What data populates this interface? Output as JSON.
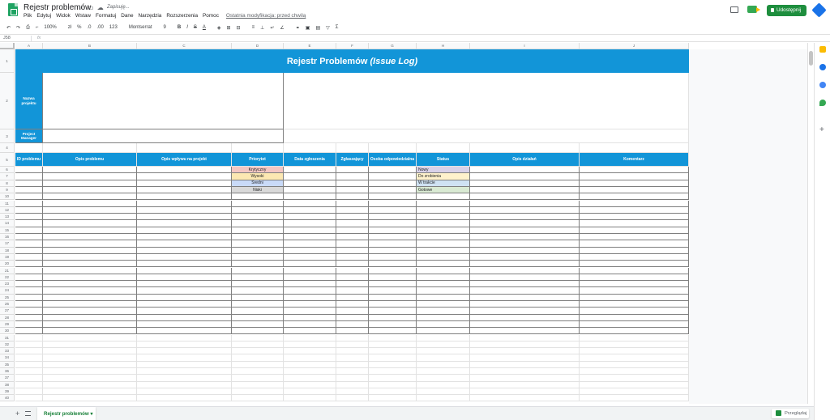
{
  "doc": {
    "title": "Rejestr problemów",
    "saving": "Zapisuję..."
  },
  "menu": [
    "Plik",
    "Edytuj",
    "Widok",
    "Wstaw",
    "Formatuj",
    "Dane",
    "Narzędzia",
    "Rozszerzenia",
    "Pomoc"
  ],
  "last_edit": "Ostatnia modyfikacja: przed chwilą",
  "share_label": "Udostępnij",
  "toolbar": {
    "zoom": "100%",
    "currency": "zł",
    "percent": "%",
    "dec_less": ".0",
    "dec_more": ".00",
    "num_format": "123",
    "font": "Montserrat",
    "font_size": "9",
    "bold": "B",
    "italic": "I",
    "strike": "S",
    "text_color": "A",
    "sigma": "Σ"
  },
  "formula_bar": {
    "namebox": "J58",
    "fx": "fx"
  },
  "columns": [
    "A",
    "B",
    "C",
    "D",
    "E",
    "F",
    "G",
    "H",
    "I",
    "J"
  ],
  "sheet": {
    "title": "Rejestr Problemów",
    "title_italic": "(Issue Log)",
    "project_labels": [
      "Nazwa projektu",
      "Project Manager"
    ],
    "headers": [
      "ID problemu",
      "Opis problemu",
      "Opis wpływu na projekt",
      "Priorytet",
      "Data zgłoszenia",
      "Zgłaszający",
      "Osoba odpowiedzialna",
      "Status",
      "Opis działań",
      "Komentarz"
    ],
    "priorities": [
      {
        "label": "Krytyczny",
        "color": "#f4c7c3"
      },
      {
        "label": "Wysoki",
        "color": "#fce8b2"
      },
      {
        "label": "Średni",
        "color": "#c9daf8"
      },
      {
        "label": "Niski",
        "color": "#d9d9d9"
      }
    ],
    "statuses": [
      {
        "label": "Nowy",
        "color": "#d9d2e9"
      },
      {
        "label": "Do zrobienia",
        "color": "#fff2cc"
      },
      {
        "label": "W trakcie",
        "color": "#cfe2f3"
      },
      {
        "label": "Gotowe",
        "color": "#d9ead3"
      }
    ]
  },
  "bottom": {
    "sheet_tab": "Rejestr problemów",
    "explore": "Przeglądaj",
    "add": "+"
  }
}
